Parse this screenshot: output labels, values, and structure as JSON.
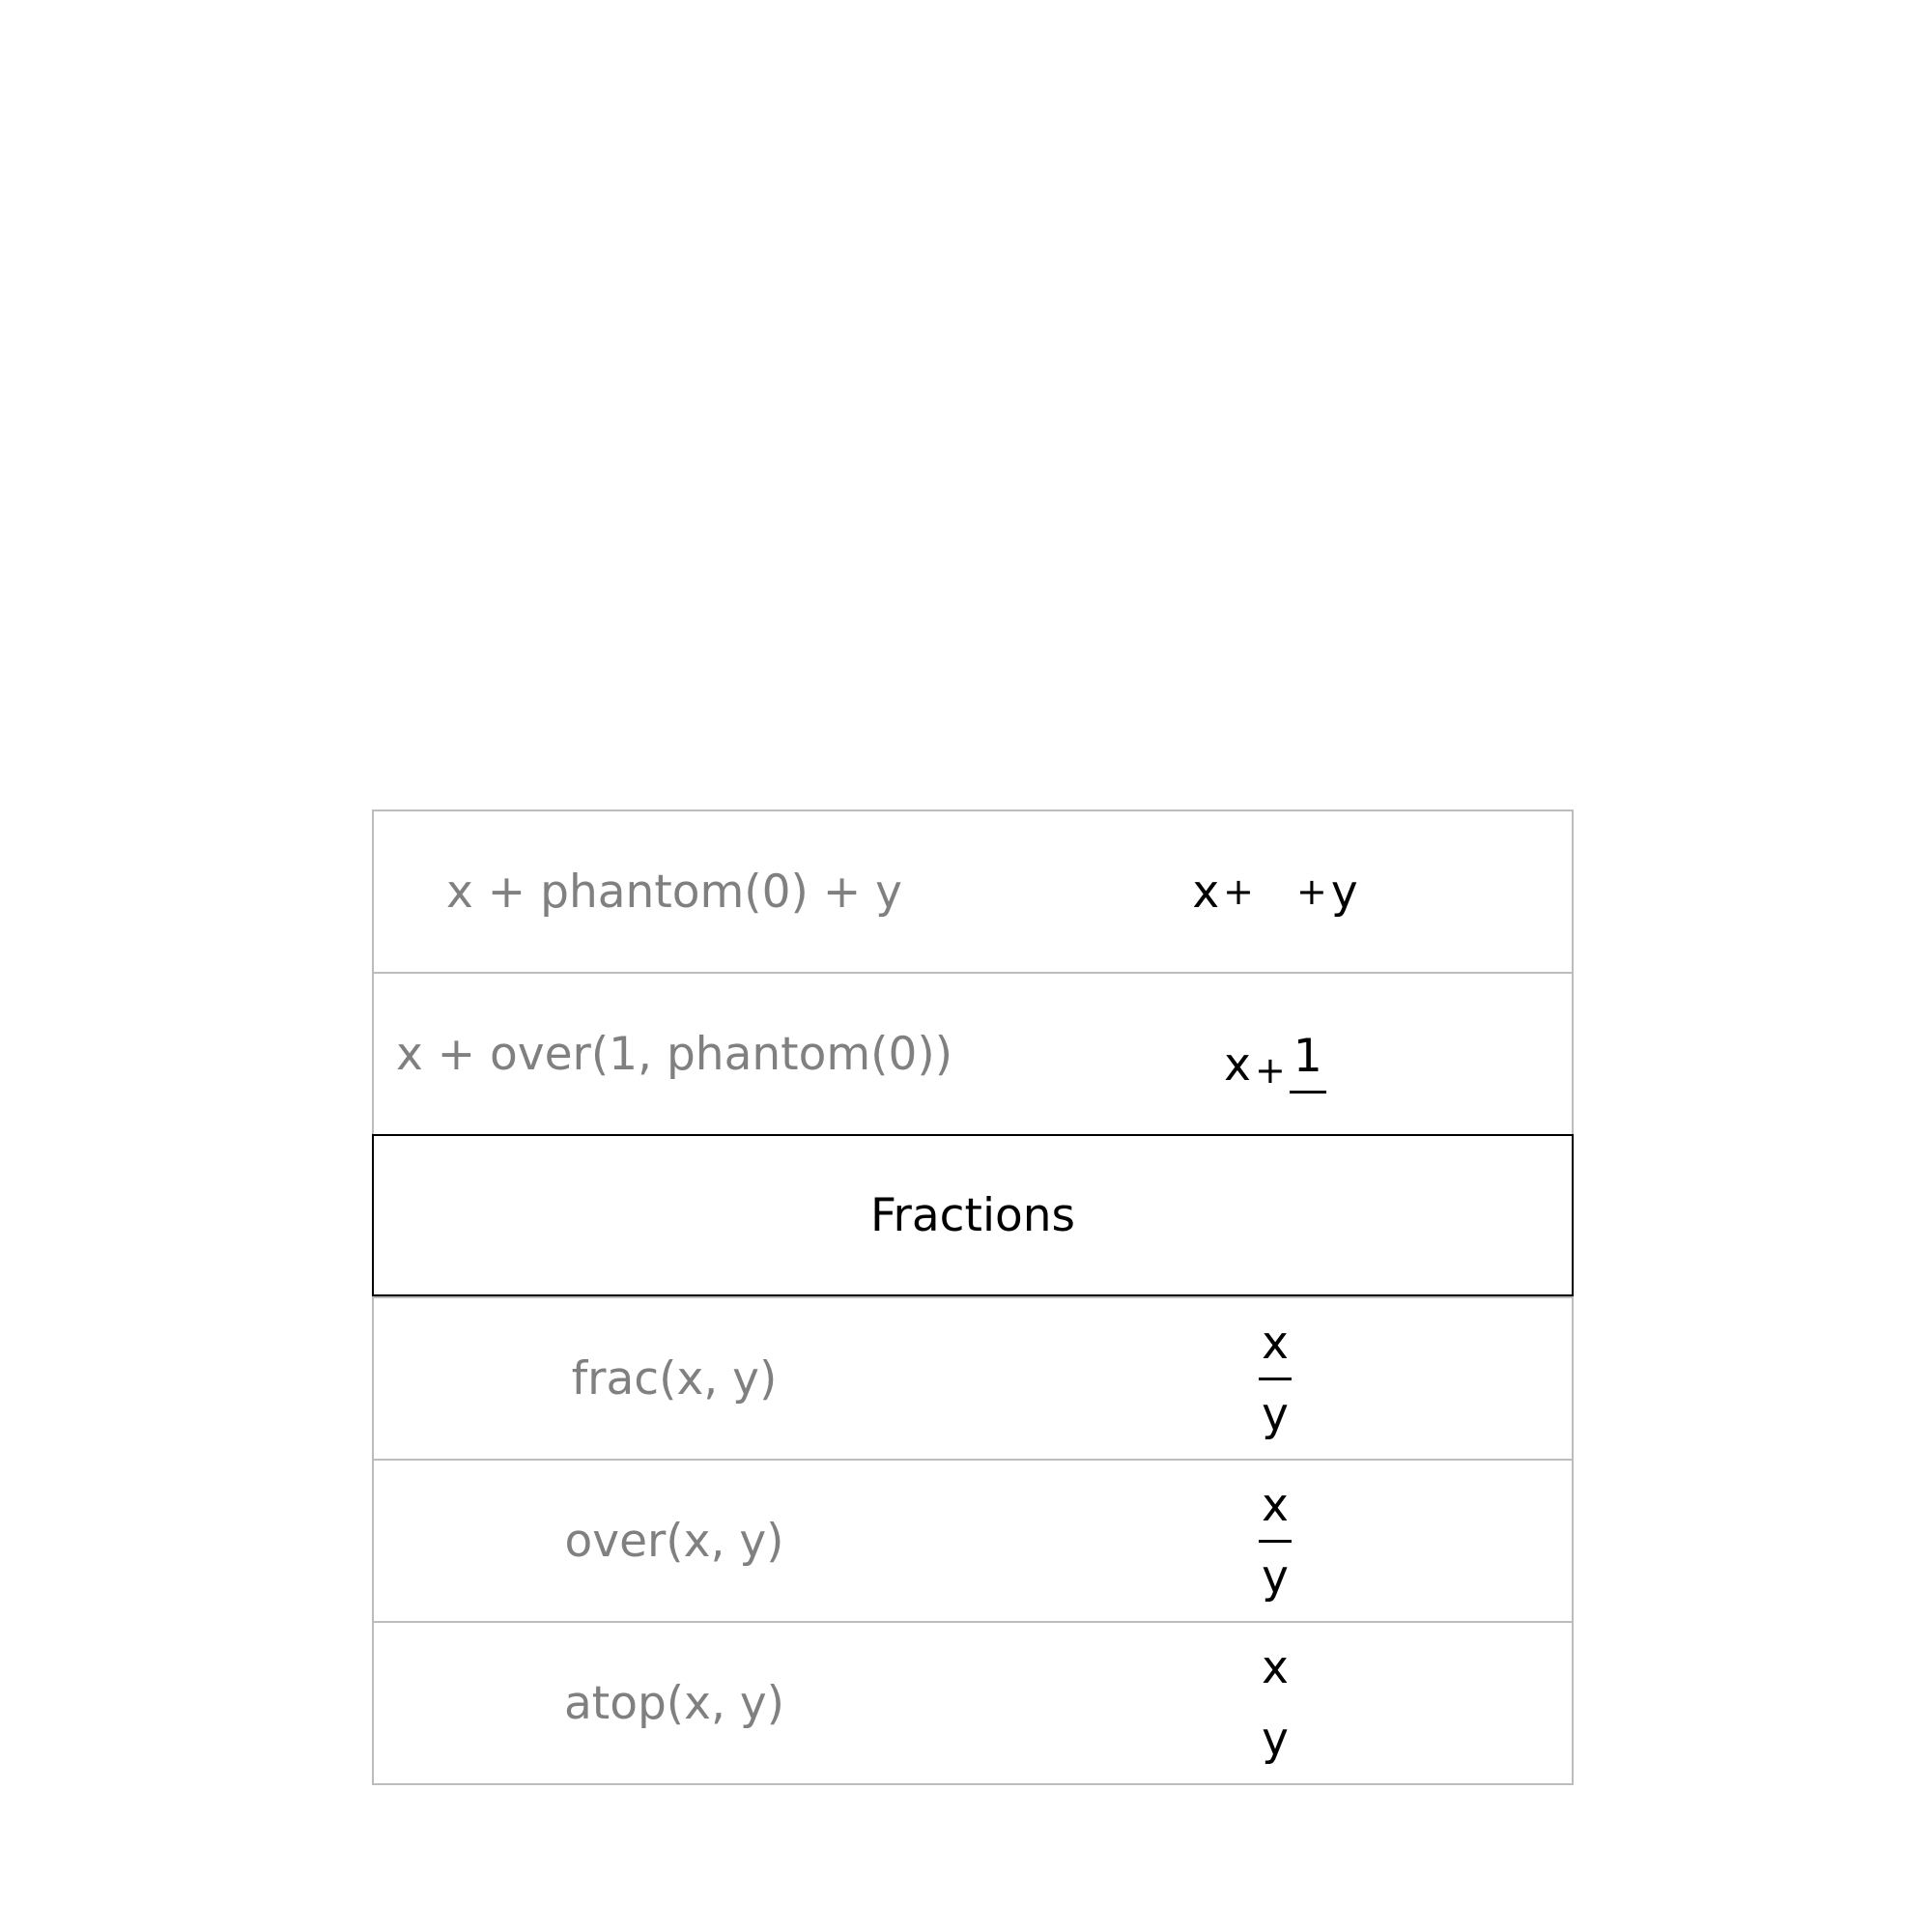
{
  "rows": [
    {
      "code": "x + phantom(0) + y",
      "rendered": {
        "a": "x",
        "op1": "+",
        "op2": "+",
        "b": "y"
      }
    },
    {
      "code": "x + over(1, phantom(0))",
      "rendered": {
        "a": "x",
        "op1": "+",
        "num": "1"
      }
    },
    {
      "header": "Fractions"
    },
    {
      "code": "frac(x, y)",
      "rendered": {
        "num": "x",
        "den": "y"
      }
    },
    {
      "code": "over(x, y)",
      "rendered": {
        "num": "x",
        "den": "y"
      }
    },
    {
      "code": "atop(x, y)",
      "rendered": {
        "num": "x",
        "den": "y"
      }
    }
  ]
}
